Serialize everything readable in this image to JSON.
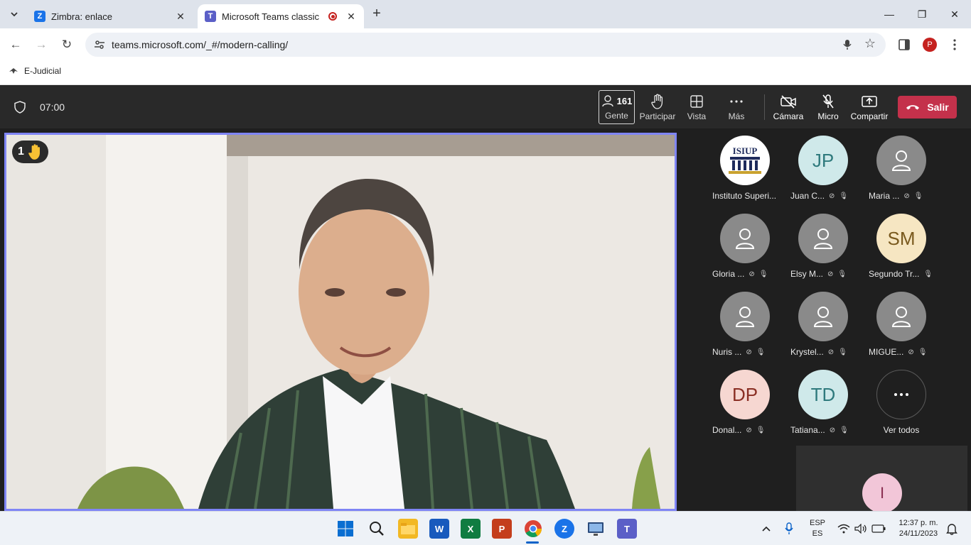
{
  "browser": {
    "tabs": [
      {
        "title": "Zimbra: enlace",
        "favicon": "Z"
      },
      {
        "title": "Microsoft Teams classic",
        "favicon": "T"
      }
    ],
    "url": "teams.microsoft.com/_#/modern-calling/",
    "profile_initial": "P",
    "bookmark": "E-Judicial"
  },
  "meeting": {
    "timer": "07:00",
    "people_count": "161",
    "controls": {
      "people": "Gente",
      "raise": "Participar",
      "view": "Vista",
      "more": "Más",
      "camera": "Cámara",
      "mic": "Micro",
      "share": "Compartir",
      "leave": "Salir"
    },
    "raised_hands": "1",
    "participants": [
      {
        "name": "Instituto Superi...",
        "initials": "ISIUP"
      },
      {
        "name": "Juan C...",
        "initials": "JP"
      },
      {
        "name": "Maria ...",
        "initials": ""
      },
      {
        "name": "Gloria ...",
        "initials": ""
      },
      {
        "name": "Elsy M...",
        "initials": ""
      },
      {
        "name": "Segundo Tr...",
        "initials": "SM"
      },
      {
        "name": "Nuris ...",
        "initials": ""
      },
      {
        "name": "Krystel...",
        "initials": ""
      },
      {
        "name": "MIGUE...",
        "initials": ""
      },
      {
        "name": "Donal...",
        "initials": "DP"
      },
      {
        "name": "Tatiana...",
        "initials": "TD"
      }
    ],
    "see_all": "Ver todos",
    "self_initial": "I"
  },
  "taskbar": {
    "language_top": "ESP",
    "language_bottom": "ES",
    "time": "12:37 p. m.",
    "date": "24/11/2023"
  },
  "colors": {
    "accent": "#7f85f5",
    "leave": "#c4314b",
    "jp_bg": "#cfe9ea",
    "sm_bg": "#f6e6c2",
    "dp_bg": "#f6d7d1",
    "td_bg": "#cfe9ea",
    "i_bg": "#f2c6d8"
  }
}
